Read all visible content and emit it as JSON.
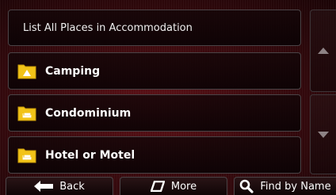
{
  "list": {
    "header": "List All Places in Accommodation",
    "items": [
      {
        "label": "Camping",
        "icon": "camping-folder-icon"
      },
      {
        "label": "Condominium",
        "icon": "condominium-folder-icon"
      },
      {
        "label": "Hotel or Motel",
        "icon": "hotel-folder-icon"
      }
    ]
  },
  "scroll": {
    "up_icon": "arrow-up-icon",
    "down_icon": "arrow-down-icon"
  },
  "bottom": {
    "back_label": "Back",
    "more_label": "More",
    "find_label": "Find by Name"
  },
  "colors": {
    "accent_yellow": "#f2c318",
    "background": "#3a0a0e",
    "text": "#ffffff"
  }
}
